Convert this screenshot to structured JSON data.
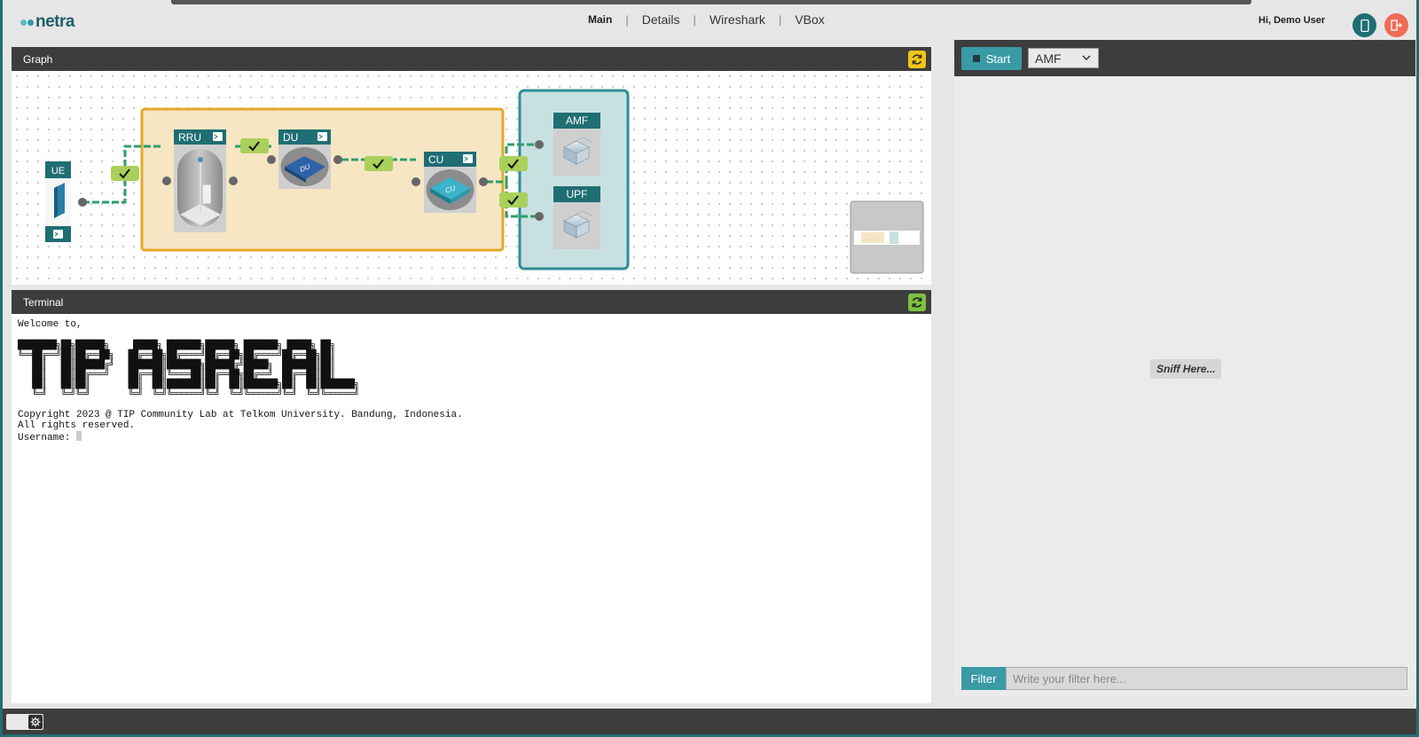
{
  "brand": {
    "name": "netra"
  },
  "nav": {
    "items": [
      "Main",
      "Details",
      "Wireshark",
      "VBox"
    ]
  },
  "user": {
    "greeting": "Hi, Demo User"
  },
  "graph": {
    "title": "Graph",
    "nodes": {
      "ue": "UE",
      "rru": "RRU",
      "du": "DU",
      "cu": "CU",
      "amf": "AMF",
      "upf": "UPF"
    },
    "icon_du": "DU",
    "icon_cu": "CU"
  },
  "terminal": {
    "title": "Terminal",
    "welcome": "Welcome to,",
    "ascii_art": "████████╗██╗██████╗     █████╗ ███████╗██████╗ ███████╗ █████╗ ██╗\n╚══██╔══╝██║██╔══██╗   ██╔══██╗██╔════╝██╔══██╗██╔════╝██╔══██╗██║\n   ██║   ██║██████╔╝   ███████║███████╗██████╔╝█████╗  ███████║██║\n   ██║   ██║██╔═══╝    ██╔══██║╚════██║██╔══██╗██╔══╝  ██╔══██║██║\n   ██║   ██║██║        ██║  ██║███████║██║  ██║███████╗██║  ██║███████╗\n   ╚═╝   ╚═╝╚═╝        ╚═╝  ╚═╝╚══════╝╚═╝  ╚═╝╚══════╝╚═╝  ╚═╝╚══════╝",
    "copyright": "Copyright 2023  @ TIP Community Lab at Telkom University. Bandung, Indonesia.",
    "rights": "All rights reserved.",
    "prompt": "Username: "
  },
  "sniffer": {
    "start_label": "Start",
    "selected_target": "AMF",
    "placeholder_text": "Sniff Here...",
    "filter_label": "Filter",
    "filter_placeholder": "Write your filter here..."
  },
  "colors": {
    "accent": "#3a9aa5",
    "dark": "#3d3d3d",
    "ran_box": "#f6e6c4",
    "ran_border": "#e5a82a",
    "core_box": "#c9e0e0",
    "core_border": "#2d8e98",
    "ok": "#a8d05a"
  }
}
